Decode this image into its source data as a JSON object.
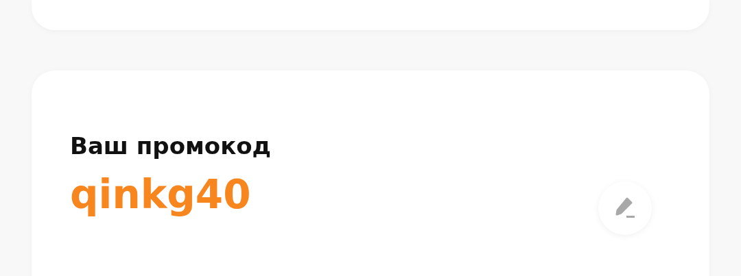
{
  "promo_card": {
    "label": "Ваш промокод",
    "code": "qinkg40"
  }
}
